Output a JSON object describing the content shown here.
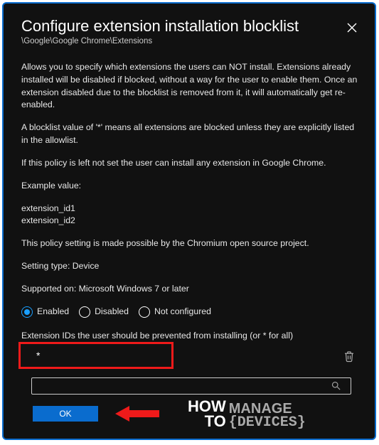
{
  "header": {
    "title": "Configure extension installation blocklist",
    "breadcrumb": "\\Google\\Google Chrome\\Extensions"
  },
  "desc": {
    "p1": "Allows you to specify which extensions the users can NOT install. Extensions already installed will be disabled if blocked, without a way for the user to enable them. Once an extension disabled due to the blocklist is removed from it, it will automatically get re-enabled.",
    "p2": "A blocklist value of '*' means all extensions are blocked unless they are explicitly listed in the allowlist.",
    "p3": "If this policy is left not set the user can install any extension in Google Chrome.",
    "exampleLabel": "Example value:",
    "ex1": "extension_id1",
    "ex2": "extension_id2",
    "p4": "This policy setting is made possible by the Chromium open source project.",
    "settingType": "Setting type: Device",
    "supported": "Supported on: Microsoft Windows 7 or later"
  },
  "radios": {
    "enabled": "Enabled",
    "disabled": "Disabled",
    "notconfig": "Not configured",
    "selected": "enabled"
  },
  "field": {
    "label": "Extension IDs the user should be prevented from installing (or * for all)",
    "value": "*"
  },
  "buttons": {
    "ok": "OK"
  },
  "watermark": {
    "how": "HOW",
    "to": "TO",
    "manage": "MANAGE",
    "devices": "{DEVICES}"
  }
}
